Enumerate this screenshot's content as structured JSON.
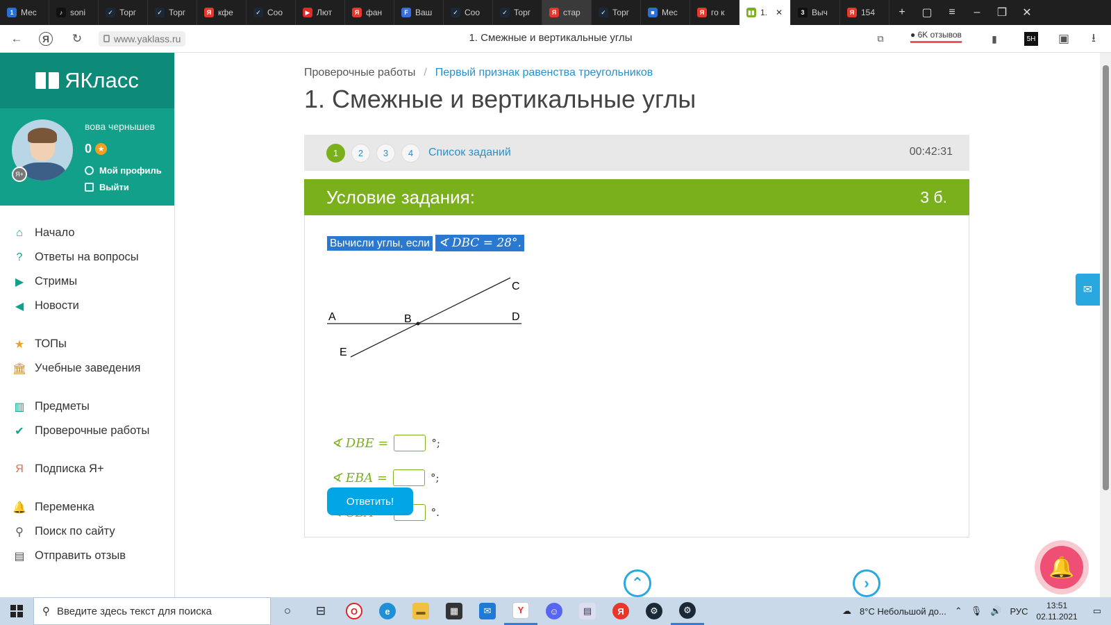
{
  "browser": {
    "tabs": [
      {
        "label": "Мес",
        "fav": "1",
        "color": "#2a6fd6"
      },
      {
        "label": "soni",
        "fav": "♪",
        "color": "#111"
      },
      {
        "label": "Торг",
        "fav": "✓",
        "color": "#1b2838"
      },
      {
        "label": "Торг",
        "fav": "✓",
        "color": "#1b2838"
      },
      {
        "label": "кфе",
        "fav": "Я",
        "color": "#e8362b"
      },
      {
        "label": "Coo",
        "fav": "✓",
        "color": "#1b2838"
      },
      {
        "label": "Лют",
        "fav": "▶",
        "color": "#e12a2a"
      },
      {
        "label": "фан",
        "fav": "Я",
        "color": "#e8362b"
      },
      {
        "label": "Ваш",
        "fav": "F",
        "color": "#3b6de0"
      },
      {
        "label": "Coo",
        "fav": "✓",
        "color": "#1b2838"
      },
      {
        "label": "Торг",
        "fav": "✓",
        "color": "#1b2838"
      },
      {
        "label": "стар",
        "fav": "Я",
        "color": "#e8362b"
      },
      {
        "label": "Торг",
        "fav": "✓",
        "color": "#1b2838"
      },
      {
        "label": "Мес",
        "fav": "■",
        "color": "#2a6fd6"
      },
      {
        "label": "го к",
        "fav": "Я",
        "color": "#e8362b"
      },
      {
        "label": "1.",
        "fav": "▮▮",
        "color": "#7bb01d"
      },
      {
        "label": "Выч",
        "fav": "3",
        "color": "#111"
      },
      {
        "label": "154",
        "fav": "Я",
        "color": "#e8362b"
      }
    ],
    "url": "www.yaklass.ru",
    "page_title": "1. Смежные и вертикальные углы",
    "reviews": "6K отзывов"
  },
  "sidebar": {
    "logo": "ЯКласс",
    "user": "вова чернышев",
    "score": "0",
    "profile_link": "Мой профиль",
    "logout_link": "Выйти",
    "nav": [
      {
        "label": "Начало",
        "icon": "home-icon"
      },
      {
        "label": "Ответы на вопросы",
        "icon": "question-icon"
      },
      {
        "label": "Стримы",
        "icon": "play-icon"
      },
      {
        "label": "Новости",
        "icon": "megaphone-icon"
      },
      {
        "label": "ТОПы",
        "icon": "star-icon"
      },
      {
        "label": "Учебные заведения",
        "icon": "school-icon"
      },
      {
        "label": "Предметы",
        "icon": "book-icon"
      },
      {
        "label": "Проверочные работы",
        "icon": "check-icon"
      },
      {
        "label": "Подписка Я+",
        "icon": "yaplus-icon"
      },
      {
        "label": "Переменка",
        "icon": "bell-icon"
      },
      {
        "label": "Поиск по сайту",
        "icon": "search-icon"
      },
      {
        "label": "Отправить отзыв",
        "icon": "feedback-icon"
      }
    ]
  },
  "main": {
    "breadcrumb": {
      "root": "Проверочные работы",
      "current": "Первый признак равенства треугольников"
    },
    "title": "1. Смежные и вертикальные углы",
    "task_numbers": [
      "1",
      "2",
      "3",
      "4"
    ],
    "current_task": "1",
    "task_list_label": "Список заданий",
    "timer": "00:42:31",
    "card_title": "Условие задания:",
    "points": "3 б.",
    "question_text": "Вычисли углы, если",
    "question_math": "∢ DBC = 28°.",
    "figure_labels": {
      "A": "A",
      "B": "B",
      "C": "C",
      "D": "D",
      "E": "E"
    },
    "answers": [
      {
        "label": "∢ DBE =",
        "end": "°;"
      },
      {
        "label": "∢ EBA =",
        "end": "°;"
      },
      {
        "label": "∢ CBA =",
        "end": "°."
      }
    ],
    "submit_label": "Ответить!"
  },
  "taskbar": {
    "search_placeholder": "Введите здесь текст для поиска",
    "weather": "8°C  Небольшой до...",
    "lang": "РУС",
    "time": "13:51",
    "date": "02.11.2021"
  },
  "colors": {
    "accent_green": "#7bb01d",
    "brand_teal": "#13a08a",
    "link_blue": "#2a8fc8"
  }
}
